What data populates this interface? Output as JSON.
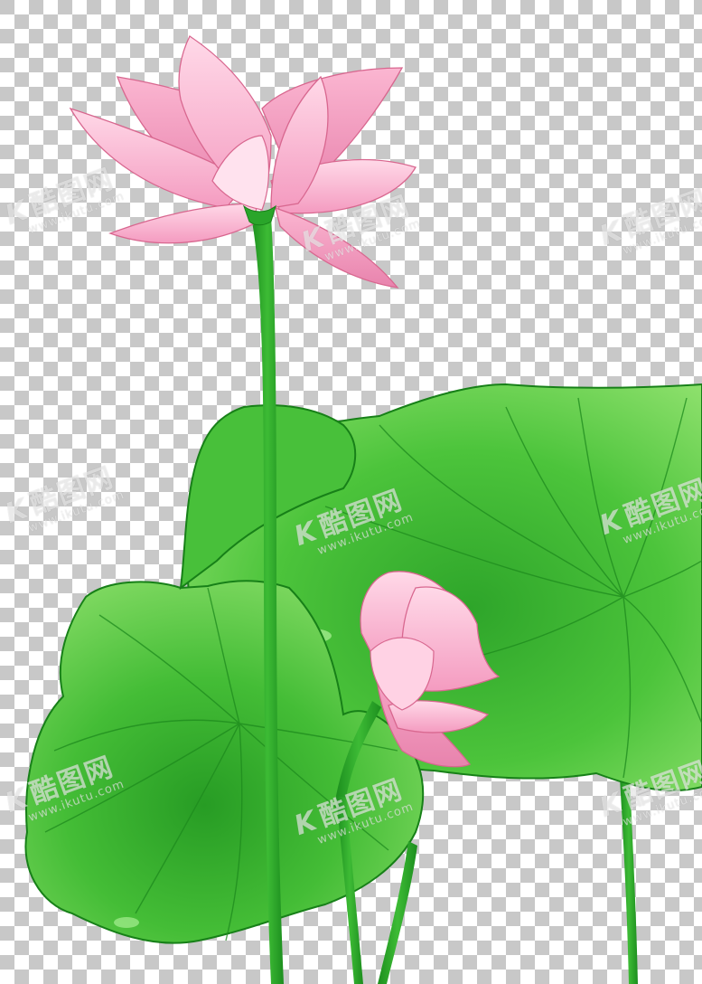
{
  "image": {
    "subject": "lotus-flowers-and-leaves",
    "background": {
      "pattern": "transparency-checkerboard",
      "light_color": "#ffffff",
      "dark_color": "#c8c8c8"
    },
    "palette": {
      "petal_light": "#ffd6e6",
      "petal_mid": "#f8a8c8",
      "petal_dark": "#e07aa2",
      "petal_edge": "#d8678f",
      "leaf_light": "#7fdc62",
      "leaf_mid": "#3ebb2e",
      "leaf_dark": "#1f9420",
      "leaf_edge": "#178018",
      "stem": "#2aa52a"
    }
  },
  "watermark": {
    "brand": "酷图网",
    "k_mark": "K",
    "url": "www.ikutu.com"
  }
}
